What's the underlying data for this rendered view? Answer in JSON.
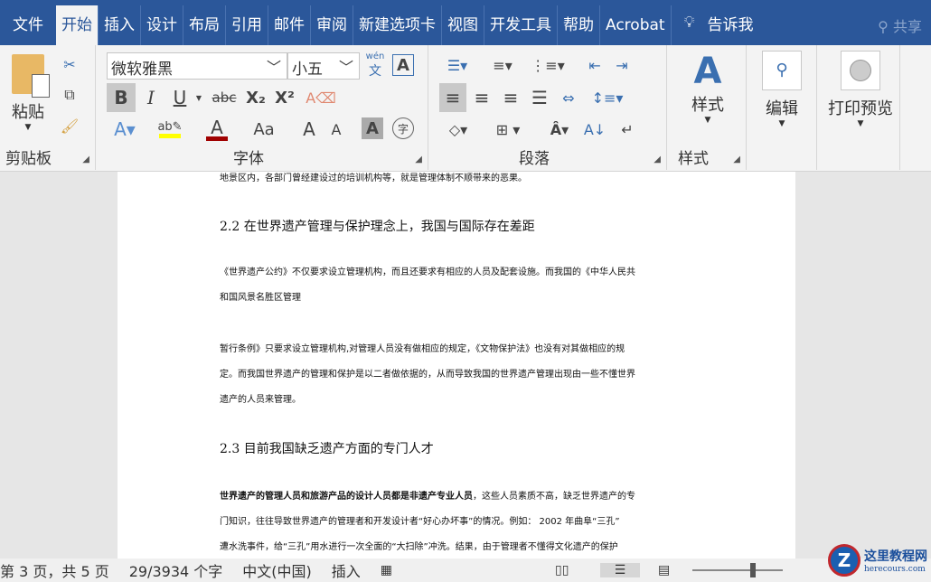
{
  "tabs": [
    "文件",
    "开始",
    "插入",
    "设计",
    "布局",
    "引用",
    "邮件",
    "审阅",
    "新建选项卡",
    "视图",
    "开发工具",
    "帮助",
    "Acrobat"
  ],
  "tell_me": "告诉我",
  "share": "共享",
  "clipboard": {
    "paste": "粘贴",
    "label": "剪贴板"
  },
  "font": {
    "name": "微软雅黑",
    "size": "小五",
    "label": "字体",
    "phonetic": "wén",
    "phonetic_char": "文",
    "bold": "B",
    "italic": "I",
    "underline": "U",
    "strike": "abc",
    "sub": "X₂",
    "sup": "X²",
    "case": "Aa",
    "grow": "A",
    "shrink": "A",
    "shade": "A",
    "enclose": "字"
  },
  "paragraph": {
    "label": "段落"
  },
  "styles": {
    "button": "样式",
    "label": "样式"
  },
  "editing": {
    "button": "编辑"
  },
  "print_preview": {
    "button": "打印预览"
  },
  "colors": {
    "ribbon_blue": "#2b579a",
    "highlight": "#ffff00",
    "font_color": "#c00000"
  },
  "document": {
    "lines": [
      "地景区内，各部门曾经建设过的培训机构等，就是管理体制不顺带来的恶果。",
      "2.2  在世界遗产管理与保护理念上，我国与国际存在差距",
      "《世界遗产公约》不仅要求设立管理机构，而且还要求有相应的人员及配套设施。而我国的《中华人民共",
      "和国风景名胜区管理",
      "暂行条例》只要求设立管理机构,对管理人员没有做相应的规定，《文物保护法》也没有对其做相应的规",
      "定。而我国世界遗产的管理和保护是以二者做依据的，从而导致我国的世界遗产管理出现由一些不懂世界",
      "遗产的人员来管理。",
      "2.3  目前我国缺乏遗产方面的专门人才",
      "世界遗产的管理人员和旅游产品的设计人员都是非遗产专业人员",
      "，这些人员素质不高，缺乏世界遗产的专",
      "门知识，往往导致世界遗产的管理者和开发设计者“好心办坏事”的情况。例如：  2002 年曲阜“三孔”",
      "遭水洗事件，给“三孔”用水进行一次全面的“大扫除”冲洗。结果，由于管理者不懂得文化遗产的保护"
    ]
  },
  "status": {
    "page": "第 3 页，共 5 页",
    "words": "29/3934 个字",
    "language": "中文(中国)",
    "mode": "插入"
  },
  "watermark": {
    "name": "这里教程网",
    "url": "herecours.com"
  }
}
